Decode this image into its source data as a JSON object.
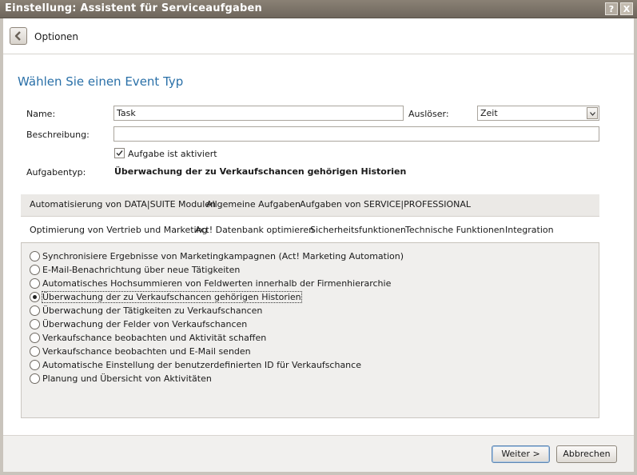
{
  "window": {
    "title": "Einstellung: Assistent für Serviceaufgaben",
    "help_symbol": "?",
    "close_symbol": "X"
  },
  "nav": {
    "back_label": "Optionen"
  },
  "heading": "Wählen Sie einen Event Typ",
  "form": {
    "name_label": "Name:",
    "name_value": "Task",
    "trigger_label": "Auslöser:",
    "trigger_value": "Zeit",
    "description_label": "Beschreibung:",
    "description_value": "",
    "active_label": "Aufgabe ist aktiviert",
    "active_checked": true,
    "tasktype_label": "Aufgabentyp:",
    "tasktype_value": "Überwachung der zu Verkaufschancen gehörigen Historien"
  },
  "tabs_row1": [
    "Automatisierung von DATA|SUITE Modulen",
    "Allgemeine Aufgaben",
    "Aufgaben von SERVICE|PROFESSIONAL"
  ],
  "tabs_row2": [
    "Optimierung von Vertrieb und Marketing",
    "Act! Datenbank optimieren",
    "Sicherheitsfunktionen",
    "Technische Funktionen",
    "Integration"
  ],
  "options": [
    "Synchronisiere Ergebnisse von Marketingkampagnen (Act! Marketing Automation)",
    "E-Mail-Benachrichtung über neue Tätigkeiten",
    "Automatisches Hochsummieren von Feldwerten innerhalb der Firmenhierarchie",
    "Überwachung der zu Verkaufschancen gehörigen Historien",
    "Überwachung der Tätigkeiten zu Verkaufschancen",
    "Überwachung der Felder von Verkaufschancen",
    "Verkaufschance beobachten und Aktivität schaffen",
    "Verkaufschance beobachten und E-Mail senden",
    "Automatische Einstellung der benutzerdefinierten ID für Verkaufschance",
    "Planung und Übersicht von Aktivitäten"
  ],
  "selected_option_index": 3,
  "buttons": {
    "next": "Weiter >",
    "cancel": "Abbrechen"
  }
}
